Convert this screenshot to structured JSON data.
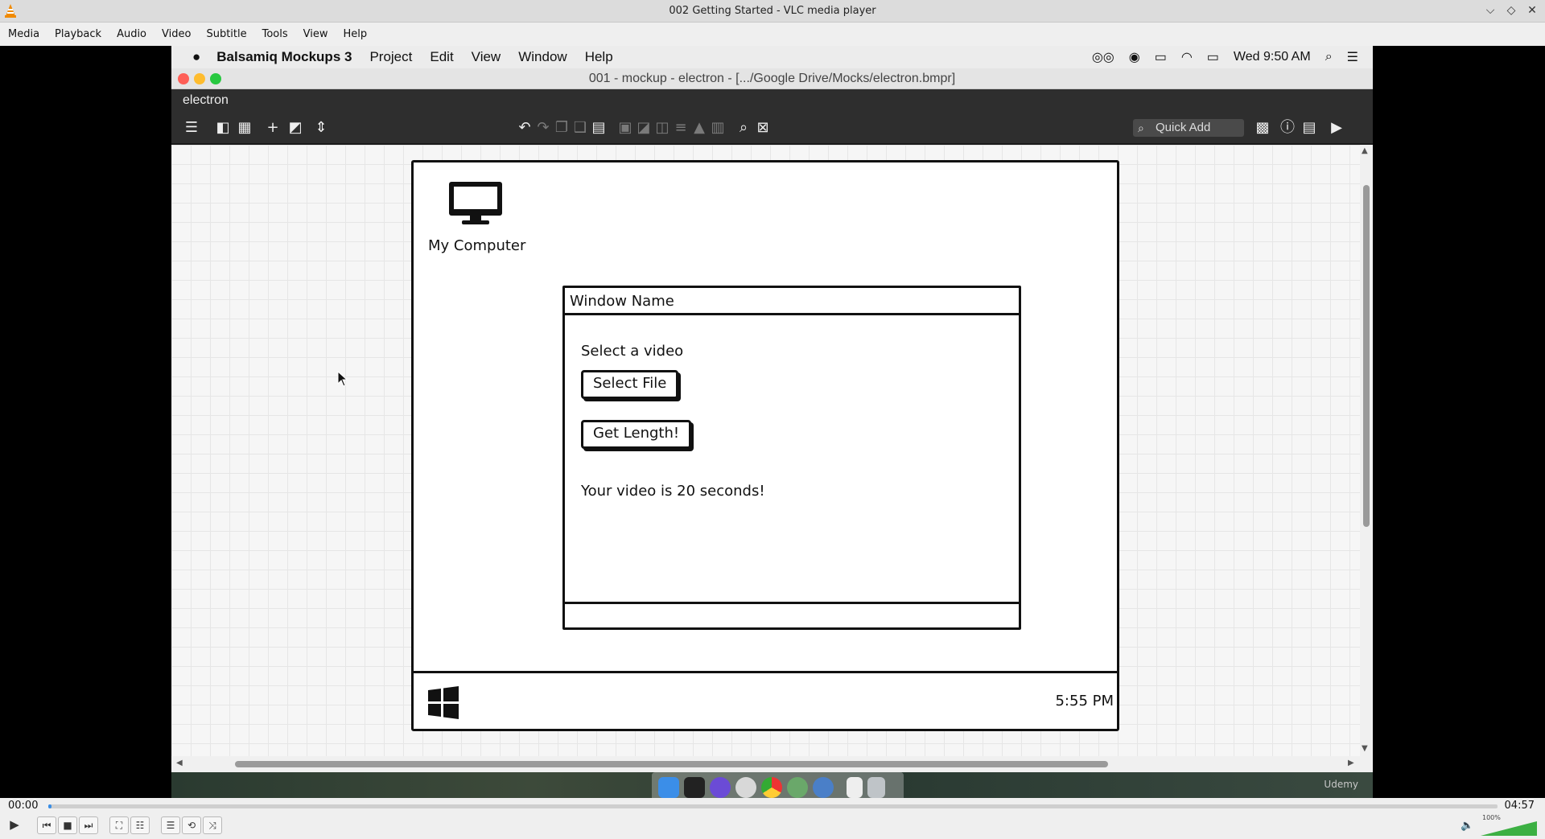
{
  "vlc": {
    "title": "002 Getting Started - VLC media player",
    "menu": [
      "Media",
      "Playback",
      "Audio",
      "Video",
      "Subtitle",
      "Tools",
      "View",
      "Help"
    ],
    "time_current": "00:00",
    "time_total": "04:57",
    "progress": 0.002,
    "volume_label": "100%",
    "volume": 1.0
  },
  "mac": {
    "app_name": "Balsamiq Mockups 3",
    "menu": [
      "Project",
      "Edit",
      "View",
      "Window",
      "Help"
    ],
    "clock": "Wed 9:50 AM"
  },
  "balsamiq": {
    "window_title": "001 - mockup - electron - [.../Google Drive/Mocks/electron.bmpr]",
    "project_name": "electron",
    "quick_add": "Quick Add"
  },
  "mockup": {
    "computer_label": "My Computer",
    "window_name": "Window Name",
    "select_label": "Select a video",
    "select_button": "Select File",
    "length_button": "Get Length!",
    "result_text": "Your video is 20 seconds!",
    "clock": "5:55 PM"
  },
  "watermark": "Udemy",
  "colors": {
    "mac_red": "#fe5f57",
    "mac_yellow": "#febc2e",
    "mac_green": "#28c840",
    "vlc_progress": "#3a8ee6",
    "vlc_volume": "#3cb043"
  }
}
